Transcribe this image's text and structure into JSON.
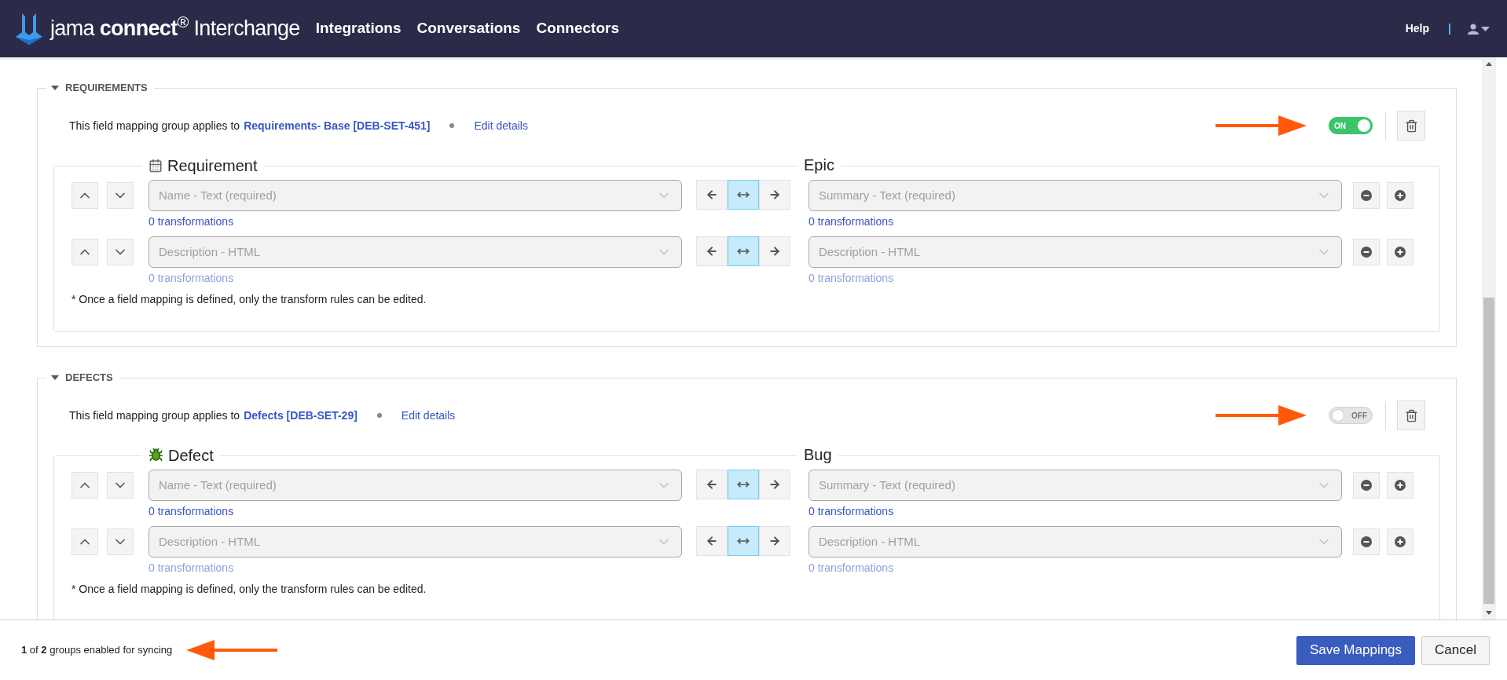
{
  "header": {
    "logo": "jama **connect**$^{®}$ Interchange",
    "nav": [
      {
        "label": "Integrations"
      },
      {
        "label": "Conversations"
      },
      {
        "label": "Connectors"
      }
    ],
    "help": "Help"
  },
  "groups": [
    {
      "title": "REQUIREMENTS",
      "expanded": true,
      "applies_text": "This field mapping group applies to",
      "target": "Requirements- Base [DEB-SET-451]",
      "edit_link": "Edit details",
      "enabled": true,
      "toggle_label": "ON",
      "source_type": {
        "name": "Requirement",
        "kind": "requirement"
      },
      "dest_type": "Epic",
      "note": "* Once a field mapping is defined, only the transform rules can be edited.",
      "rows": [
        {
          "source": "Name - Text (required)",
          "source_link": "0 transformations",
          "dest": "Summary - Text (required)",
          "dest_link": "0 transformations",
          "links_disabled": false,
          "directions": [
            {
              "kind": "left",
              "selected": false
            },
            {
              "kind": "both",
              "selected": true
            },
            {
              "kind": "right",
              "selected": false
            }
          ]
        },
        {
          "source": "Description - HTML",
          "source_link": "0 transformations",
          "dest": "Description - HTML",
          "dest_link": "0 transformations",
          "links_disabled": true,
          "directions": [
            {
              "kind": "left",
              "selected": false
            },
            {
              "kind": "both",
              "selected": true
            },
            {
              "kind": "right",
              "selected": false
            }
          ]
        }
      ]
    },
    {
      "title": "DEFECTS",
      "expanded": true,
      "applies_text": "This field mapping group applies to",
      "target": "Defects [DEB-SET-29]",
      "edit_link": "Edit details",
      "enabled": false,
      "toggle_label": "OFF",
      "source_type": {
        "name": "Defect",
        "kind": "defect"
      },
      "dest_type": "Bug",
      "note": "* Once a field mapping is defined, only the transform rules can be edited.",
      "rows": [
        {
          "source": "Name - Text (required)",
          "source_link": "0 transformations",
          "dest": "Summary - Text (required)",
          "dest_link": "0 transformations",
          "links_disabled": false,
          "directions": [
            {
              "kind": "left",
              "selected": false
            },
            {
              "kind": "both",
              "selected": true
            },
            {
              "kind": "right",
              "selected": false
            }
          ]
        },
        {
          "source": "Description - HTML",
          "source_link": "0 transformations",
          "dest": "Description - HTML",
          "dest_link": "0 transformations",
          "links_disabled": true,
          "directions": [
            {
              "kind": "left",
              "selected": false
            },
            {
              "kind": "both",
              "selected": true
            },
            {
              "kind": "right",
              "selected": false
            }
          ]
        }
      ]
    }
  ],
  "footer": {
    "status": "**1** of **2** groups enabled for syncing",
    "buttons": [
      {
        "label": "Save Mappings",
        "kind": "primary"
      },
      {
        "label": "Cancel",
        "kind": "secondary"
      }
    ]
  }
}
